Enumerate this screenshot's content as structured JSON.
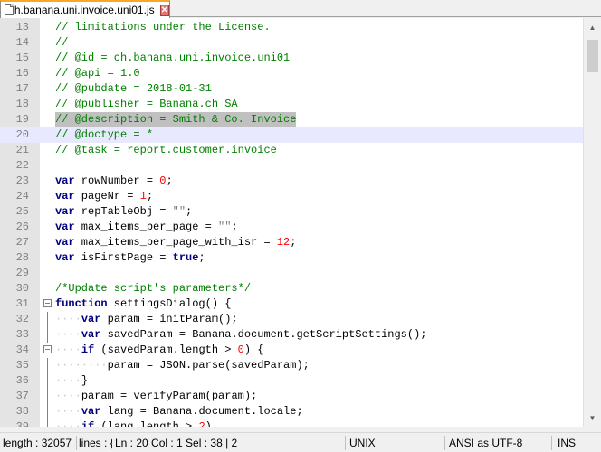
{
  "tab": {
    "title": "ch.banana.uni.invoice.uni01.js",
    "icon": "file-icon",
    "close_icon": "close-icon"
  },
  "editor": {
    "current_line": 20,
    "selected_line": 19,
    "lines": [
      {
        "n": "13",
        "indent": "",
        "fold": "",
        "tokens": [
          {
            "t": "cm",
            "v": "// limitations under the License."
          }
        ]
      },
      {
        "n": "14",
        "indent": "",
        "fold": "",
        "tokens": [
          {
            "t": "cm",
            "v": "//"
          }
        ]
      },
      {
        "n": "15",
        "indent": "",
        "fold": "",
        "tokens": [
          {
            "t": "cm",
            "v": "// @id = ch.banana.uni.invoice.uni01"
          }
        ]
      },
      {
        "n": "16",
        "indent": "",
        "fold": "",
        "tokens": [
          {
            "t": "cm",
            "v": "// @api = 1.0"
          }
        ]
      },
      {
        "n": "17",
        "indent": "",
        "fold": "",
        "tokens": [
          {
            "t": "cm",
            "v": "// @pubdate = 2018-01-31"
          }
        ]
      },
      {
        "n": "18",
        "indent": "",
        "fold": "",
        "tokens": [
          {
            "t": "cm",
            "v": "// @publisher = Banana.ch SA"
          }
        ]
      },
      {
        "n": "19",
        "indent": "",
        "fold": "",
        "sel": true,
        "tokens": [
          {
            "t": "cm",
            "v": "// @description = Smith & Co. Invoice"
          }
        ]
      },
      {
        "n": "20",
        "indent": "",
        "fold": "",
        "current": true,
        "tokens": [
          {
            "t": "cm",
            "v": "// @doctype = *"
          }
        ]
      },
      {
        "n": "21",
        "indent": "",
        "fold": "",
        "tokens": [
          {
            "t": "cm",
            "v": "// @task = report.customer.invoice"
          }
        ]
      },
      {
        "n": "22",
        "indent": "",
        "fold": "",
        "tokens": []
      },
      {
        "n": "23",
        "indent": "",
        "fold": "",
        "tokens": [
          {
            "t": "kw",
            "v": "var"
          },
          {
            "t": "tx",
            "v": " rowNumber = "
          },
          {
            "t": "num",
            "v": "0"
          },
          {
            "t": "tx",
            "v": ";"
          }
        ]
      },
      {
        "n": "24",
        "indent": "",
        "fold": "",
        "tokens": [
          {
            "t": "kw",
            "v": "var"
          },
          {
            "t": "tx",
            "v": " pageNr = "
          },
          {
            "t": "num",
            "v": "1"
          },
          {
            "t": "tx",
            "v": ";"
          }
        ]
      },
      {
        "n": "25",
        "indent": "",
        "fold": "",
        "tokens": [
          {
            "t": "kw",
            "v": "var"
          },
          {
            "t": "tx",
            "v": " repTableObj = "
          },
          {
            "t": "str",
            "v": "\"\""
          },
          {
            "t": "tx",
            "v": ";"
          }
        ]
      },
      {
        "n": "26",
        "indent": "",
        "fold": "",
        "tokens": [
          {
            "t": "kw",
            "v": "var"
          },
          {
            "t": "tx",
            "v": " max_items_per_page = "
          },
          {
            "t": "str",
            "v": "\"\""
          },
          {
            "t": "tx",
            "v": ";"
          }
        ]
      },
      {
        "n": "27",
        "indent": "",
        "fold": "",
        "tokens": [
          {
            "t": "kw",
            "v": "var"
          },
          {
            "t": "tx",
            "v": " max_items_per_page_with_isr = "
          },
          {
            "t": "num",
            "v": "12"
          },
          {
            "t": "tx",
            "v": ";"
          }
        ]
      },
      {
        "n": "28",
        "indent": "",
        "fold": "",
        "tokens": [
          {
            "t": "kw",
            "v": "var"
          },
          {
            "t": "tx",
            "v": " isFirstPage = "
          },
          {
            "t": "kw",
            "v": "true"
          },
          {
            "t": "tx",
            "v": ";"
          }
        ]
      },
      {
        "n": "29",
        "indent": "",
        "fold": "",
        "tokens": []
      },
      {
        "n": "30",
        "indent": "",
        "fold": "",
        "tokens": [
          {
            "t": "cm",
            "v": "/*Update script's parameters*/"
          }
        ]
      },
      {
        "n": "31",
        "indent": "",
        "fold": "box",
        "tokens": [
          {
            "t": "kw",
            "v": "function"
          },
          {
            "t": "tx",
            "v": " settingsDialog() {"
          }
        ]
      },
      {
        "n": "32",
        "indent": "····",
        "fold": "vline",
        "tokens": [
          {
            "t": "kw",
            "v": "var"
          },
          {
            "t": "tx",
            "v": " param = initParam();"
          }
        ]
      },
      {
        "n": "33",
        "indent": "····",
        "fold": "vline",
        "tokens": [
          {
            "t": "kw",
            "v": "var"
          },
          {
            "t": "tx",
            "v": " savedParam = Banana.document.getScriptSettings();"
          }
        ]
      },
      {
        "n": "34",
        "indent": "····",
        "fold": "box",
        "tokens": [
          {
            "t": "kw",
            "v": "if"
          },
          {
            "t": "tx",
            "v": " (savedParam.length > "
          },
          {
            "t": "num",
            "v": "0"
          },
          {
            "t": "tx",
            "v": ") {"
          }
        ]
      },
      {
        "n": "35",
        "indent": "········",
        "fold": "vline",
        "tokens": [
          {
            "t": "tx",
            "v": "param = JSON.parse(savedParam);"
          }
        ]
      },
      {
        "n": "36",
        "indent": "····",
        "fold": "vline",
        "tokens": [
          {
            "t": "tx",
            "v": "}"
          }
        ]
      },
      {
        "n": "37",
        "indent": "····",
        "fold": "vline",
        "tokens": [
          {
            "t": "tx",
            "v": "param = verifyParam(param);"
          }
        ]
      },
      {
        "n": "38",
        "indent": "····",
        "fold": "vline",
        "tokens": [
          {
            "t": "kw",
            "v": "var"
          },
          {
            "t": "tx",
            "v": " lang = Banana.document.locale;"
          }
        ]
      },
      {
        "n": "39",
        "indent": "····",
        "fold": "vline",
        "tokens": [
          {
            "t": "kw",
            "v": "if"
          },
          {
            "t": "tx",
            "v": " (lang.length > "
          },
          {
            "t": "num",
            "v": "2"
          },
          {
            "t": "tx",
            "v": ")"
          }
        ]
      }
    ]
  },
  "scrollbar": {
    "up_icon": "arrow-up-icon",
    "down_icon": "arrow-down-icon"
  },
  "status": {
    "length": "length : 32057",
    "lines": "lines : {",
    "position": "Ln : 20    Col : 1    Sel : 38 | 2",
    "eol": "UNIX",
    "encoding": "ANSI as UTF-8",
    "mode": "INS"
  },
  "colors": {
    "comment": "#008000",
    "keyword": "#000080",
    "number": "#ff0000",
    "string": "#808080",
    "current_line": "#e8e8ff",
    "selection": "#c0c0c0",
    "tab_accent": "#f9a825"
  }
}
